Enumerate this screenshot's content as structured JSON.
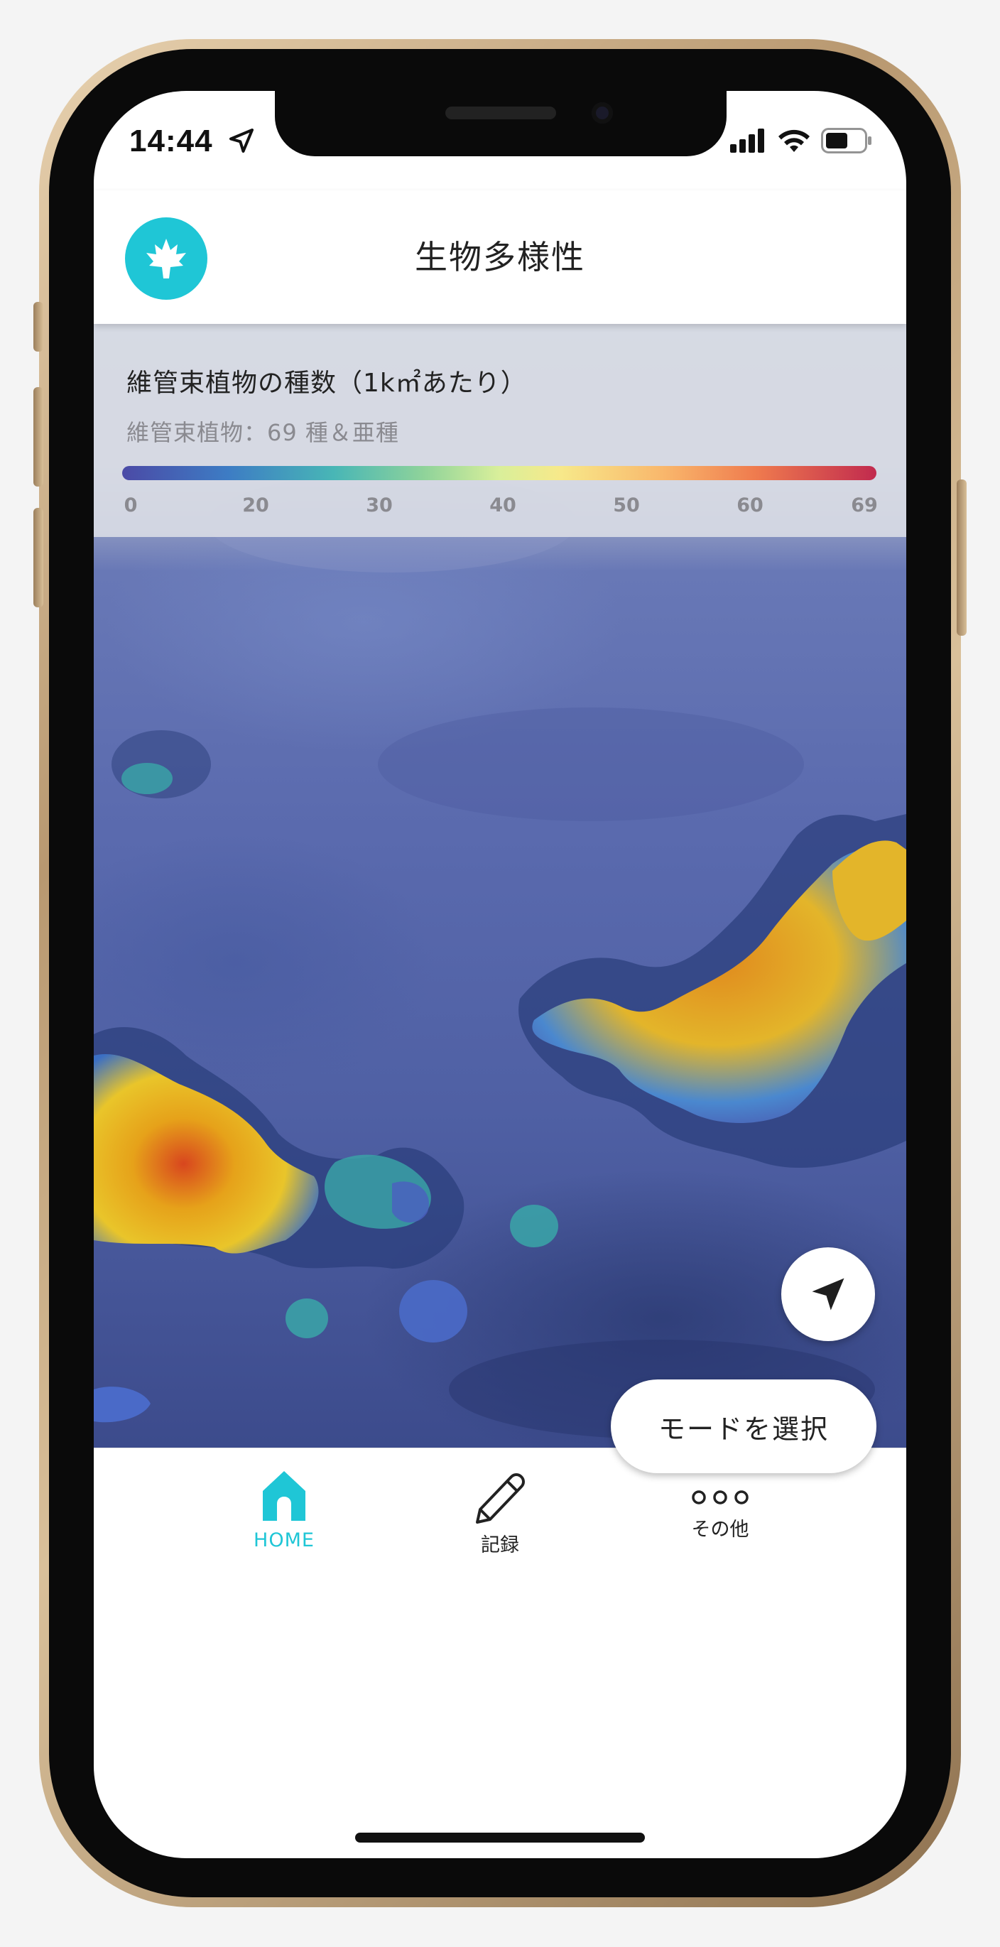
{
  "status_bar": {
    "time": "14:44"
  },
  "header": {
    "title": "生物多様性"
  },
  "legend": {
    "title": "維管束植物の種数（1k㎡あたり）",
    "subtitle": "維管束植物：69 種＆亜種",
    "ticks": [
      "0",
      "20",
      "30",
      "40",
      "50",
      "60",
      "69"
    ]
  },
  "map_controls": {
    "mode_button": "モードを選択"
  },
  "tabs": [
    {
      "label": "HOME",
      "icon": "home-icon",
      "active": true
    },
    {
      "label": "記録",
      "icon": "pencil-icon",
      "active": false
    },
    {
      "label": "その他",
      "icon": "more-icon",
      "active": false
    }
  ],
  "colors": {
    "accent": "#1fc6d6",
    "legend_low": "#4b4aa6",
    "legend_mid": "#f7e98a",
    "legend_high": "#c12a4e"
  }
}
